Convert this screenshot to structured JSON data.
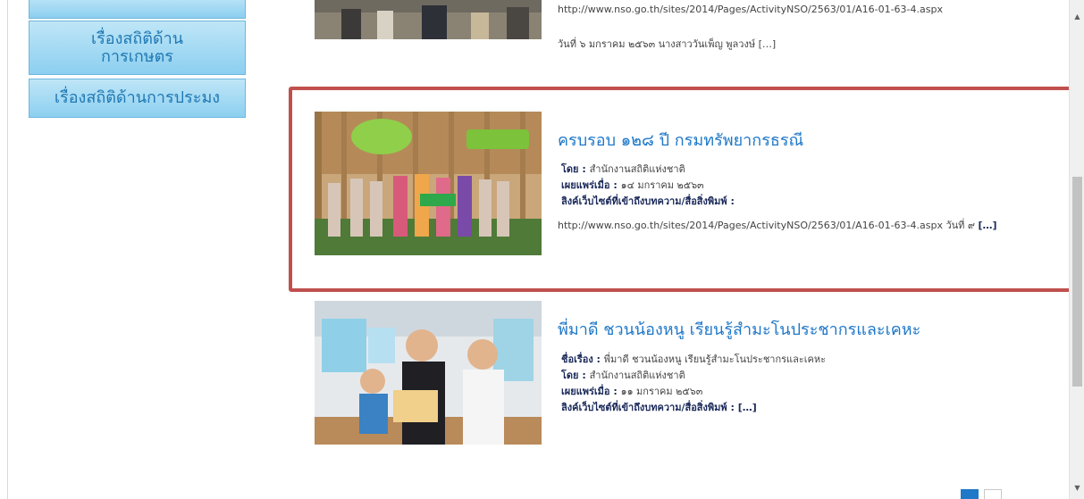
{
  "sidebar": {
    "items": [
      {
        "label": ""
      },
      {
        "label": "เรื่องสถิติด้าน การเกษตร",
        "line1": "เรื่องสถิติด้าน",
        "line2": "การเกษตร"
      },
      {
        "label": "เรื่องสถิติด้านการประมง"
      }
    ]
  },
  "article0": {
    "url_line": "http://www.nso.go.th/sites/2014/Pages/ActivityNSO/2563/01/A16-01-63-4.aspx",
    "date_line": "วันที่ ๖ มกราคม ๒๕๖๓ นางสาววันเพ็ญ พูลวงษ์ […]"
  },
  "article1": {
    "title": "ครบรอบ ๑๒๘ ปี กรมทรัพยากรธรณี",
    "by_label": "โดย",
    "by_value": "สำนักงานสถิติแห่งชาติ",
    "published_label": "เผยแพร่เมื่อ",
    "published_value": "๑๔ มกราคม ๒๕๖๓",
    "link_label": "ลิงค์เว็บไซต์ที่เข้าถึงบทความ/สื่อสิ่งพิมพ์",
    "link_value": "http://www.nso.go.th/sites/2014/Pages/ActivityNSO/2563/01/A16-01-63-4.aspx วันที่ ๙",
    "more": "[…]"
  },
  "article2": {
    "title": "พี่มาดี ชวนน้องหนู เรียนรู้สำมะโนประชากรและเคหะ",
    "subject_label": "ชื่อเรื่อง",
    "subject_value": "พี่มาดี ชวนน้องหนู เรียนรู้สำมะโนประชากรและเคหะ",
    "by_label": "โดย",
    "by_value": "สำนักงานสถิติแห่งชาติ",
    "published_label": "เผยแพร่เมื่อ",
    "published_value": "๑๑ มกราคม ๒๕๖๓",
    "link_label": "ลิงค์เว็บไซต์ที่เข้าถึงบทความ/สื่อสิ่งพิมพ์",
    "more": "[…]"
  },
  "scrollbar": {
    "up_icon": "up-arrow-icon",
    "down_icon": "down-arrow-icon"
  },
  "colors": {
    "accent": "#1f78c8",
    "highlight": "#c0504d",
    "sidebar": "#8ccff0",
    "pager_active": "#1f78c8"
  }
}
